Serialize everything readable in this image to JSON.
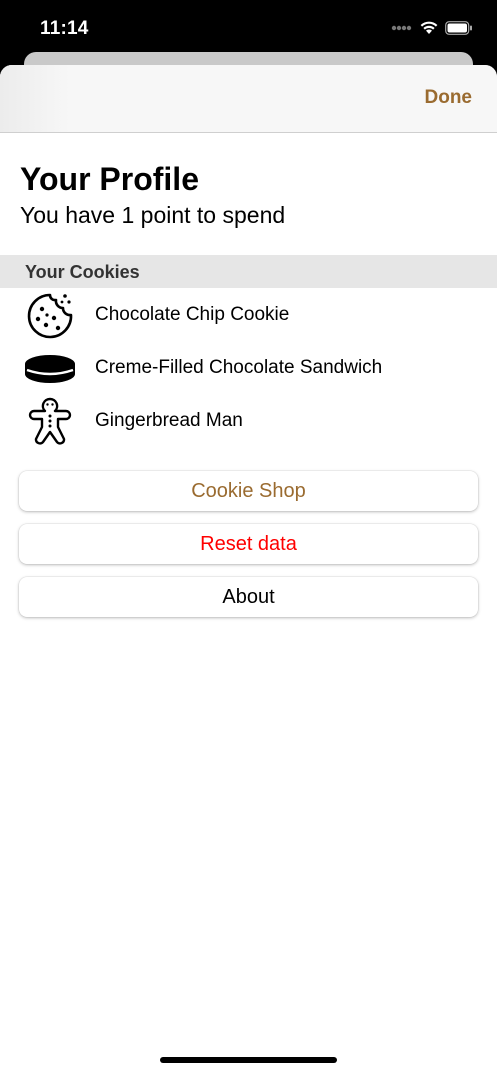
{
  "status_bar": {
    "time": "11:14",
    "icons": [
      "signal-dots-icon",
      "wifi-icon",
      "battery-icon"
    ]
  },
  "nav": {
    "done_label": "Done"
  },
  "profile": {
    "title": "Your Profile",
    "subtitle": "You have 1 point to spend"
  },
  "cookies": {
    "header": "Your Cookies",
    "items": [
      {
        "label": "Chocolate Chip Cookie",
        "icon": "chocolate-chip-cookie-icon"
      },
      {
        "label": "Creme-Filled Chocolate Sandwich",
        "icon": "sandwich-cookie-icon"
      },
      {
        "label": "Gingerbread Man",
        "icon": "gingerbread-man-icon"
      }
    ]
  },
  "actions": {
    "shop_label": "Cookie Shop",
    "reset_label": "Reset data",
    "about_label": "About"
  },
  "colors": {
    "accent": "#9a6b30",
    "destructive": "#ff0000",
    "section_bg": "#e6e6e6"
  }
}
